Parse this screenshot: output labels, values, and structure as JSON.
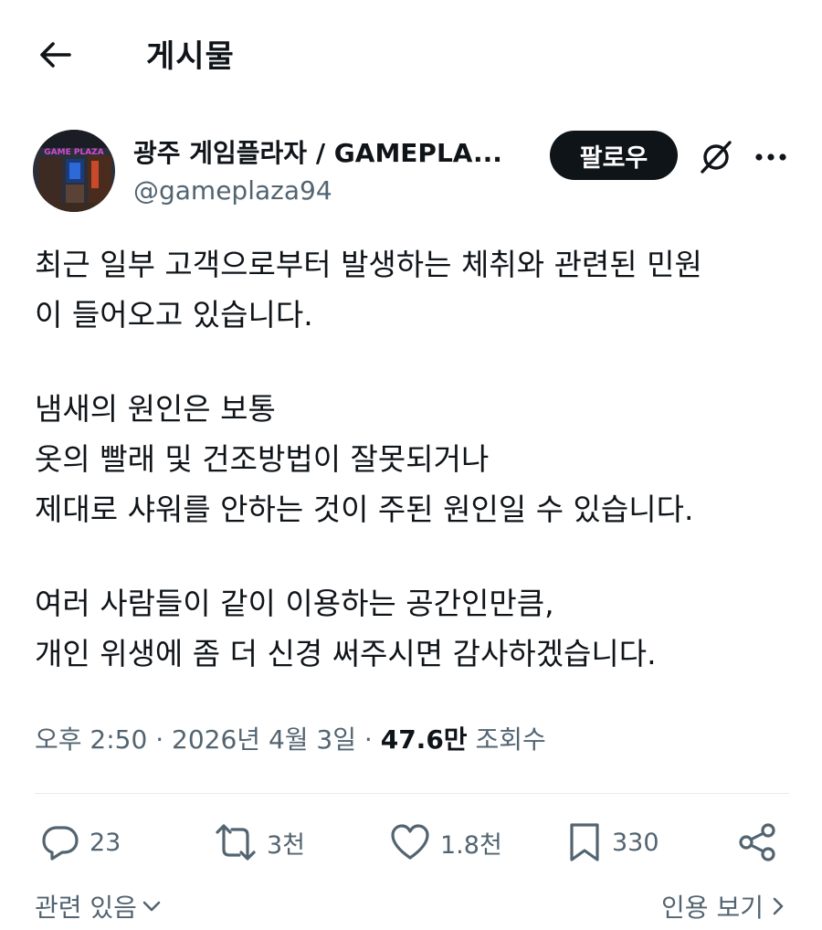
{
  "header": {
    "title": "게시물"
  },
  "author": {
    "name": "광주 게임플라자 / GAMEPLA...",
    "handle": "@gameplaza94",
    "avatar_text": "GAME PLAZA",
    "follow_label": "팔로우"
  },
  "post": {
    "paragraphs": [
      [
        "최근 일부 고객으로부터 발생하는 체취와 관련된 민원",
        "이 들어오고 있습니다."
      ],
      [
        "냄새의 원인은 보통",
        "옷의 빨래 및 건조방법이 잘못되거나",
        "제대로 샤워를 안하는 것이 주된 원인일 수 있습니다."
      ],
      [
        "여러 사람들이 같이 이용하는 공간인만큼,",
        "개인 위생에 좀 더 신경 써주시면 감사하겠습니다."
      ]
    ],
    "time": "오후 2:50",
    "separator": "·",
    "date": "2026년 4월 3일",
    "views_count": "47.6만",
    "views_label": "조회수"
  },
  "actions": {
    "replies": "23",
    "reposts": "3천",
    "likes": "1.8천",
    "bookmarks": "330"
  },
  "footer": {
    "related_label": "관련 있음",
    "quotes_label": "인용 보기"
  },
  "icons": [
    "back-arrow-icon",
    "grok-icon",
    "more-icon",
    "reply-icon",
    "repost-icon",
    "like-icon",
    "bookmark-icon",
    "share-icon",
    "chevron-down-icon",
    "chevron-right-icon"
  ],
  "colors": {
    "text": "#0f1419",
    "muted": "#536471",
    "follow_bg": "#0f1419",
    "divider": "#e6ecf0"
  }
}
